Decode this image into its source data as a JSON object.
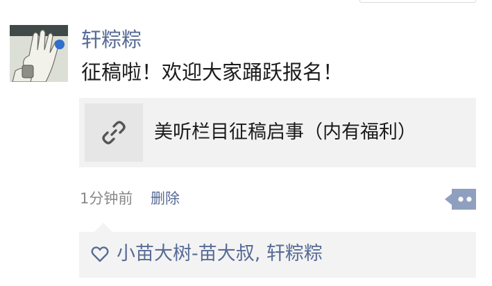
{
  "post": {
    "author": "轩粽粽",
    "text": "征稿啦！欢迎大家踊跃报名！",
    "link": {
      "title": "美听栏目征稿启事（内有福利）",
      "icon": "link-icon"
    },
    "time": "1分钟前",
    "delete_label": "删除",
    "more_icon": "more-dots-icon"
  },
  "likes": {
    "icon": "heart-icon",
    "names": "小苗大树-苗大叔, 轩粽粽"
  },
  "colors": {
    "name_blue": "#576b95",
    "text": "#1b1b1b",
    "muted": "#888888",
    "panel": "#f2f2f2"
  }
}
